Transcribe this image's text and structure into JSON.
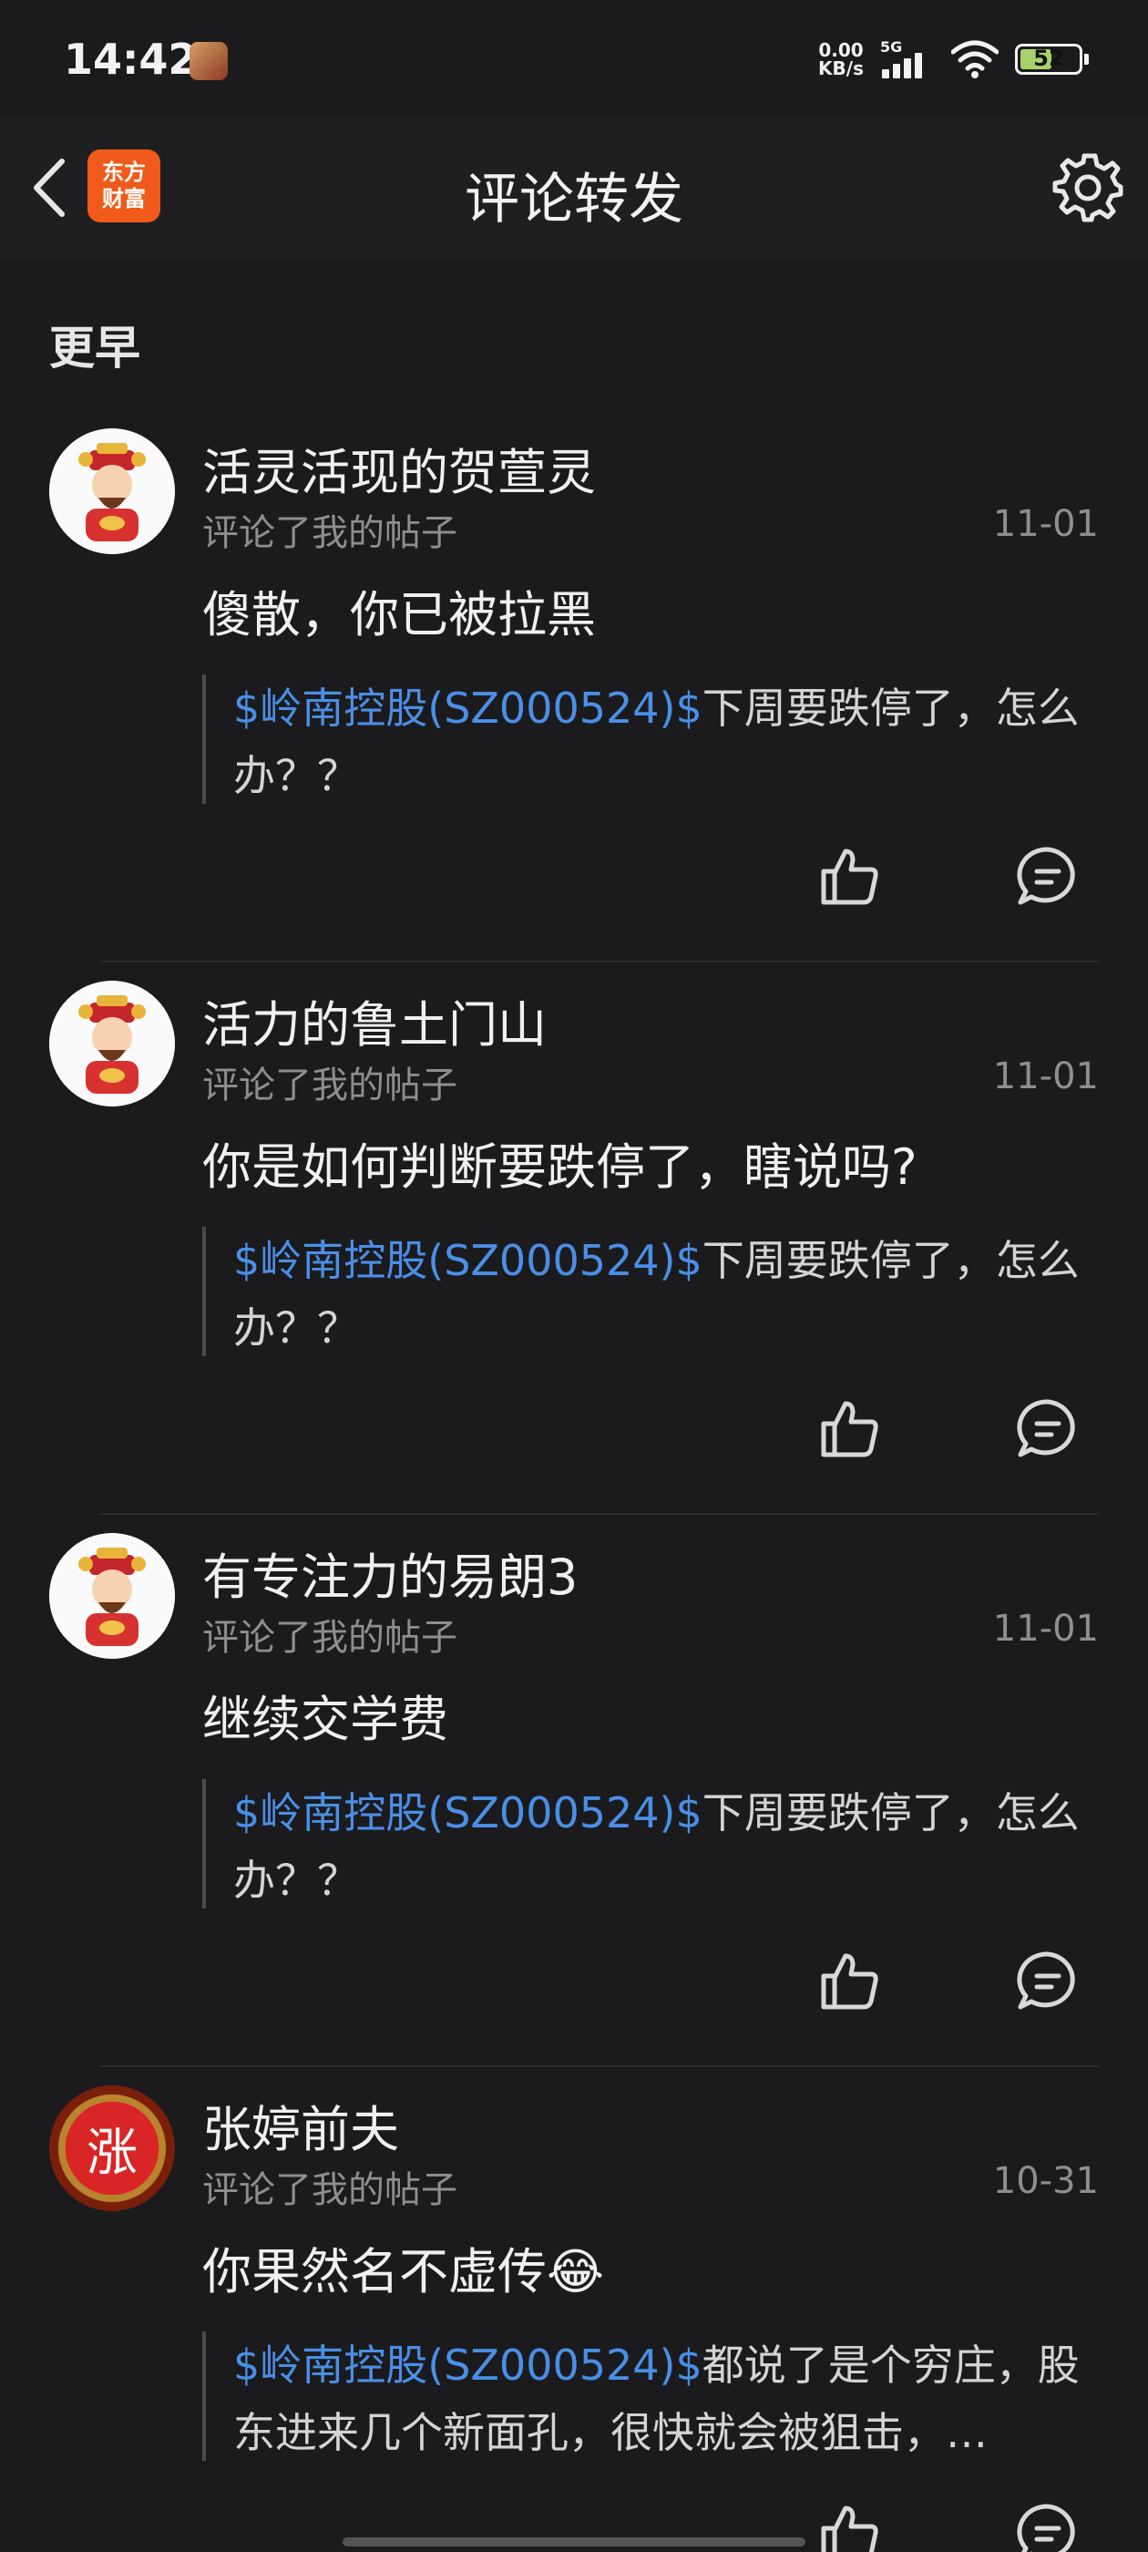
{
  "status_bar": {
    "time": "14:42",
    "net_speed_value": "0.00",
    "net_speed_unit": "KB/s",
    "network": "5G",
    "battery": "52"
  },
  "header": {
    "logo_line1": "东方",
    "logo_line2": "财富",
    "title": "评论转发"
  },
  "section_title": "更早",
  "items": [
    {
      "user": "活灵活现的贺萱灵",
      "action": "评论了我的帖子",
      "date": "11-01",
      "comment": "傻散，你已被拉黑",
      "stock": "$岭南控股(SZ000524)$",
      "quote_text": "下周要跌停了，怎么办？？"
    },
    {
      "user": "活力的鲁土门山",
      "action": "评论了我的帖子",
      "date": "11-01",
      "comment": "你是如何判断要跌停了，瞎说吗?",
      "stock": "$岭南控股(SZ000524)$",
      "quote_text": "下周要跌停了，怎么办？？"
    },
    {
      "user": "有专注力的易朗3",
      "action": "评论了我的帖子",
      "date": "11-01",
      "comment": "继续交学费",
      "stock": "$岭南控股(SZ000524)$",
      "quote_text": "下周要跌停了，怎么办？？"
    },
    {
      "user": "张婷前夫",
      "avatar_text": "涨",
      "action": "评论了我的帖子",
      "date": "10-31",
      "comment": "你果然名不虚传😂",
      "stock": "$岭南控股(SZ000524)$",
      "quote_text": "都说了是个穷庄，股东进来几个新面孔，很快就会被狙击，…"
    }
  ],
  "icons": {
    "back": "chevron-left-icon",
    "settings": "gear-icon",
    "like": "thumbs-up-icon",
    "reply": "comment-bubble-icon"
  },
  "colors": {
    "background": "#1b1b1d",
    "stock_link": "#4a8fe7",
    "logo": "#f05a1a"
  }
}
